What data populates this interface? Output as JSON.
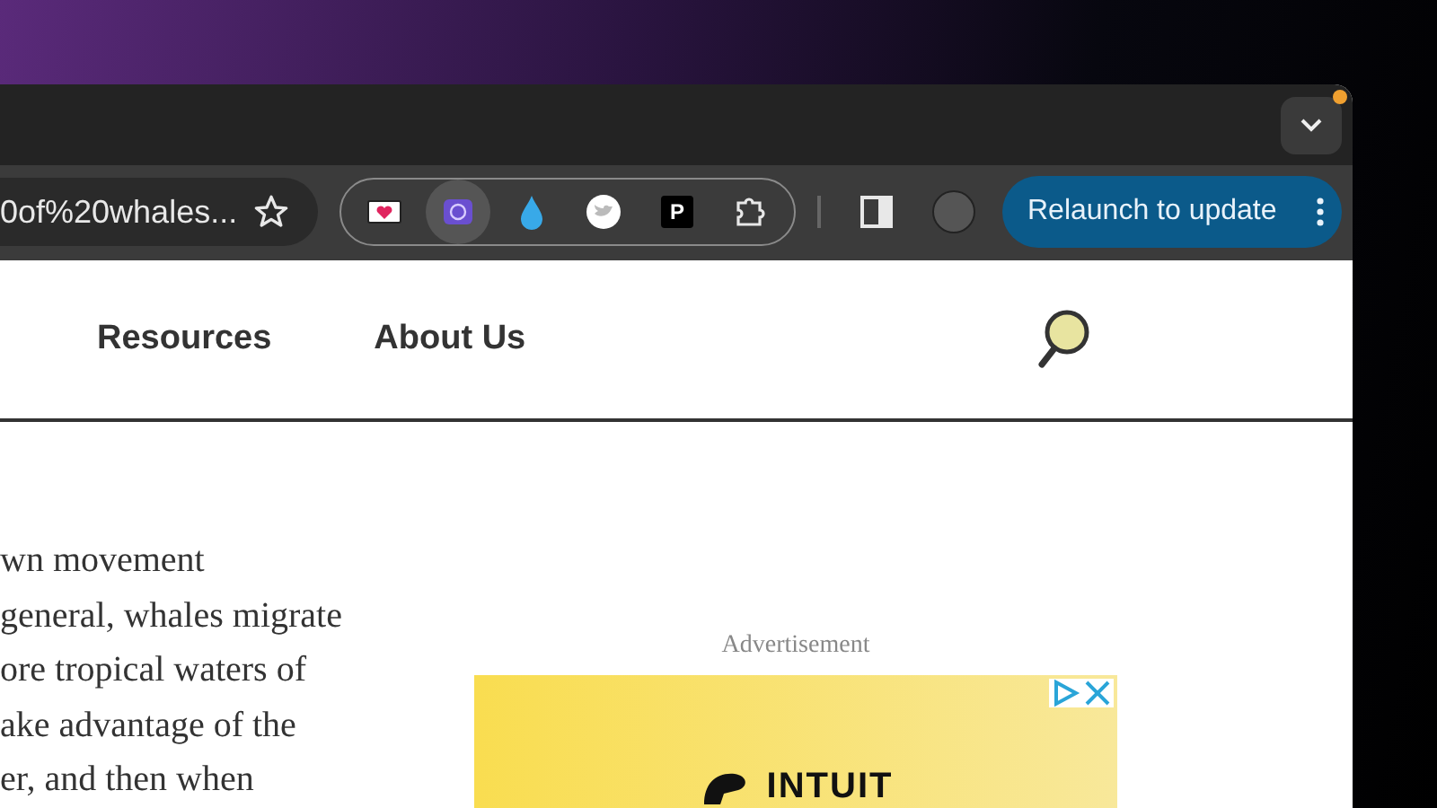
{
  "address_bar": {
    "text": "0of%20whales..."
  },
  "extensions": [
    {
      "kind": "mail",
      "hovered": false
    },
    {
      "kind": "badge",
      "hovered": true
    },
    {
      "kind": "drop",
      "hovered": false
    },
    {
      "kind": "bird",
      "hovered": false
    },
    {
      "kind": "letter",
      "label": "P",
      "hovered": false
    },
    {
      "kind": "puzzle",
      "hovered": false
    }
  ],
  "update_button": {
    "label": "Relaunch to update"
  },
  "tab_strip": {
    "update_dot": true
  },
  "site_nav": {
    "items": [
      "Resources",
      "About Us"
    ]
  },
  "article": {
    "lines": [
      "wn movement",
      "general, whales migrate",
      "ore tropical waters of",
      "ake advantage of the",
      "er, and then when"
    ]
  },
  "ad": {
    "label": "Advertisement",
    "logo": "INTUIT"
  }
}
